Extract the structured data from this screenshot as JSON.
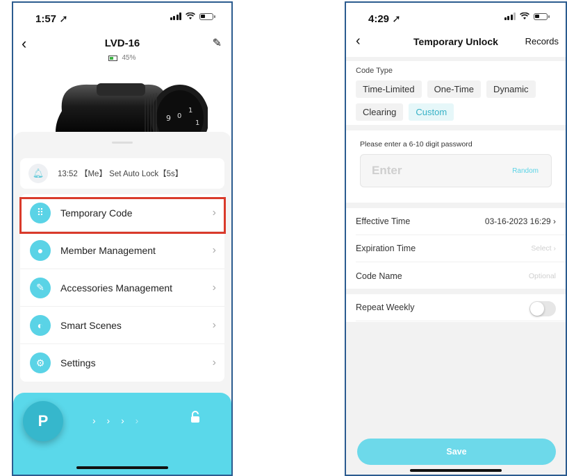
{
  "left_screen": {
    "status": {
      "time": "1:57",
      "location_arrow": "➚"
    },
    "header": {
      "back_glyph": "‹",
      "title": "LVD-16",
      "edit_glyph": "✎"
    },
    "battery": {
      "level_text": "45%",
      "level": 0.45,
      "color": "#3cb043"
    },
    "log": {
      "icon": "bell-icon",
      "text": "13:52 【Me】 Set Auto Lock【5s】"
    },
    "menu": [
      {
        "label": "Temporary Code",
        "icon": "keypad-icon"
      },
      {
        "label": "Member Management",
        "icon": "person-icon"
      },
      {
        "label": "Accessories Management",
        "icon": "brush-icon"
      },
      {
        "label": "Smart Scenes",
        "icon": "toggle-icon"
      },
      {
        "label": "Settings",
        "icon": "gear-icon"
      }
    ],
    "chevron": "›",
    "unlock": {
      "key_glyph": "P",
      "arrows": "› › ›",
      "arrows_faded": " ›",
      "lock_glyph": "🔓"
    },
    "highlight_color": "#d93a2b"
  },
  "right_screen": {
    "status": {
      "time": "4:29",
      "location_arrow": "➚"
    },
    "header": {
      "back_glyph": "‹",
      "title": "Temporary Unlock",
      "records": "Records"
    },
    "code_type": {
      "heading": "Code Type",
      "options": [
        "Time-Limited",
        "One-Time",
        "Dynamic",
        "Clearing",
        "Custom"
      ],
      "selected": "Custom"
    },
    "password": {
      "hint": "Please enter a 6-10 digit password",
      "placeholder": "Enter",
      "random": "Random"
    },
    "fields": {
      "effective": {
        "label": "Effective Time",
        "value": "03-16-2023 16:29 ›"
      },
      "expiration": {
        "label": "Expiration Time",
        "value": "Select ›"
      },
      "name": {
        "label": "Code Name",
        "value": "Optional"
      }
    },
    "repeat": {
      "label": "Repeat Weekly",
      "enabled": false
    },
    "save": "Save"
  },
  "colors": {
    "accent": "#5ad3e6",
    "bar": "#5ad8ea",
    "frame": "#2b5b8f"
  }
}
